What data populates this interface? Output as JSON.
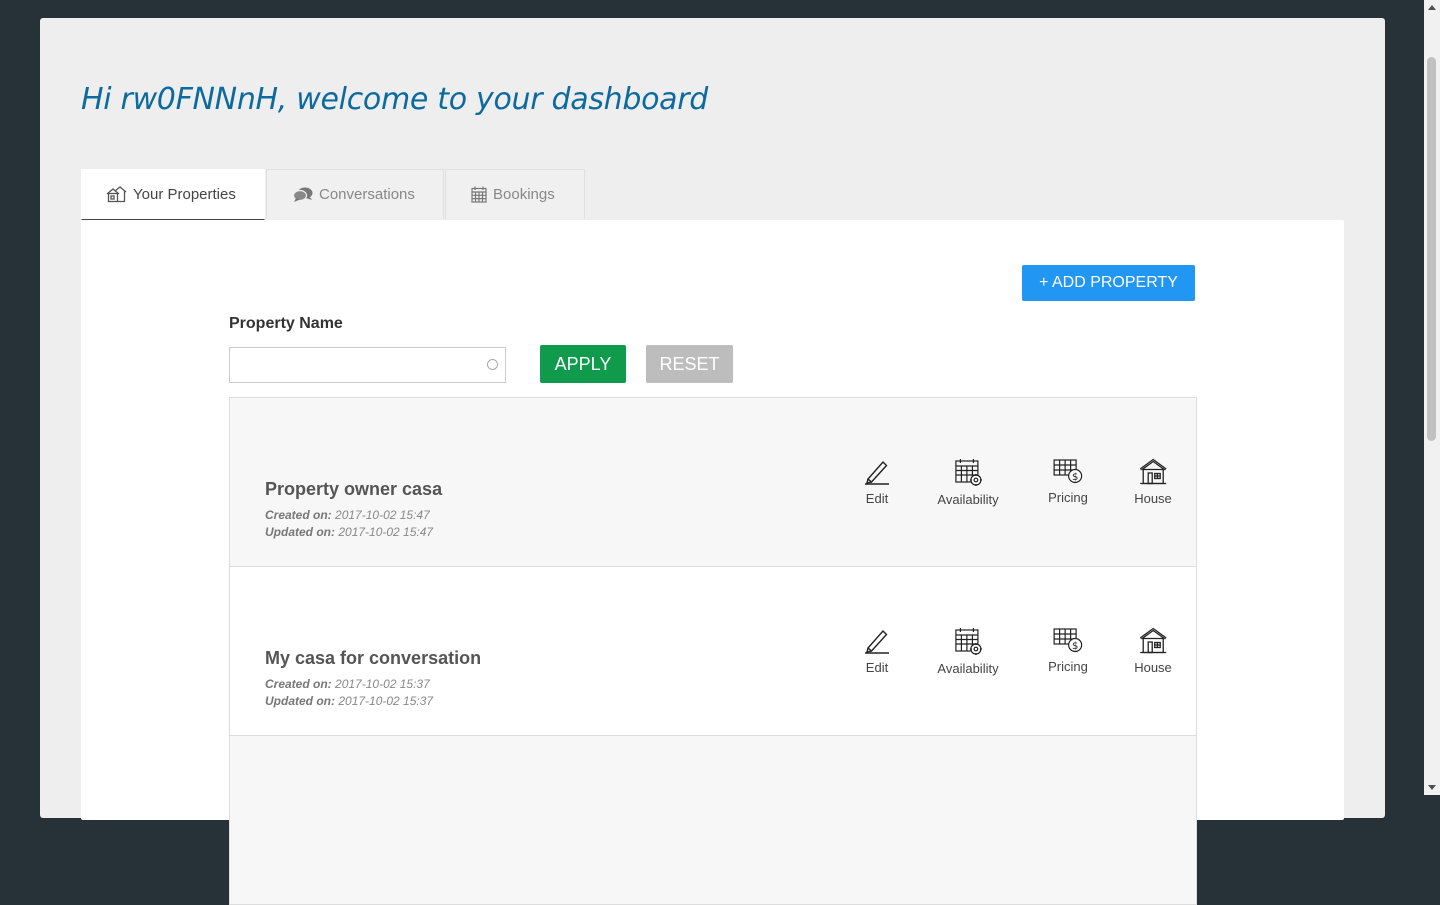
{
  "welcome": "Hi rw0FNNnH, welcome to your dashboard",
  "tabs": [
    {
      "label": "Your Properties",
      "icon": "houses-icon",
      "active": true
    },
    {
      "label": "Conversations",
      "icon": "chat-bubbles-icon",
      "active": false
    },
    {
      "label": "Bookings",
      "icon": "calendar-icon",
      "active": false
    }
  ],
  "add_property_label": "+ ADD PROPERTY",
  "filter": {
    "label": "Property Name",
    "value": "",
    "apply_label": "APPLY",
    "reset_label": "RESET"
  },
  "properties": [
    {
      "title": "Property owner casa",
      "created_label": "Created on:",
      "created": "2017-10-02 15:47",
      "updated_label": "Updated on:",
      "updated": "2017-10-02 15:47"
    },
    {
      "title": "My casa for conversation",
      "created_label": "Created on:",
      "created": "2017-10-02 15:37",
      "updated_label": "Updated on:",
      "updated": "2017-10-02 15:37"
    }
  ],
  "actions": {
    "edit": "Edit",
    "availability": "Availability",
    "pricing": "Pricing",
    "house": "House"
  },
  "colors": {
    "accent": "#2196f3",
    "apply": "#0f9b4b",
    "reset": "#bdbdbd",
    "heading": "#0d6a9e",
    "page_bg": "#263238"
  }
}
